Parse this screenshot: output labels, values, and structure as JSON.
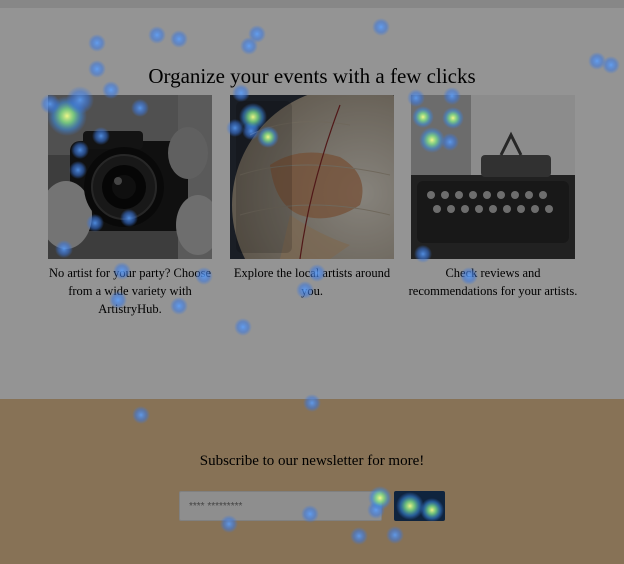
{
  "page": {
    "headline": "Organize your events with a few clicks"
  },
  "cards": [
    {
      "image_icon": "camera-photo",
      "caption": "No artist for your party? Choose from a wide variety with ArtistryHub."
    },
    {
      "image_icon": "globe-photo",
      "caption": "Explore the local artists around you."
    },
    {
      "image_icon": "typewriter-photo",
      "caption": "Check reviews and recommendations for your artists."
    }
  ],
  "newsletter": {
    "title": "Subscribe to our newsletter for more!",
    "email_placeholder": "**** *********",
    "background_color": "#e8c594",
    "button_color": "#1a3f6b"
  },
  "overlay": {
    "type": "gaze-heatmap",
    "dim_color": "rgba(0,0,0,0.42)"
  }
}
